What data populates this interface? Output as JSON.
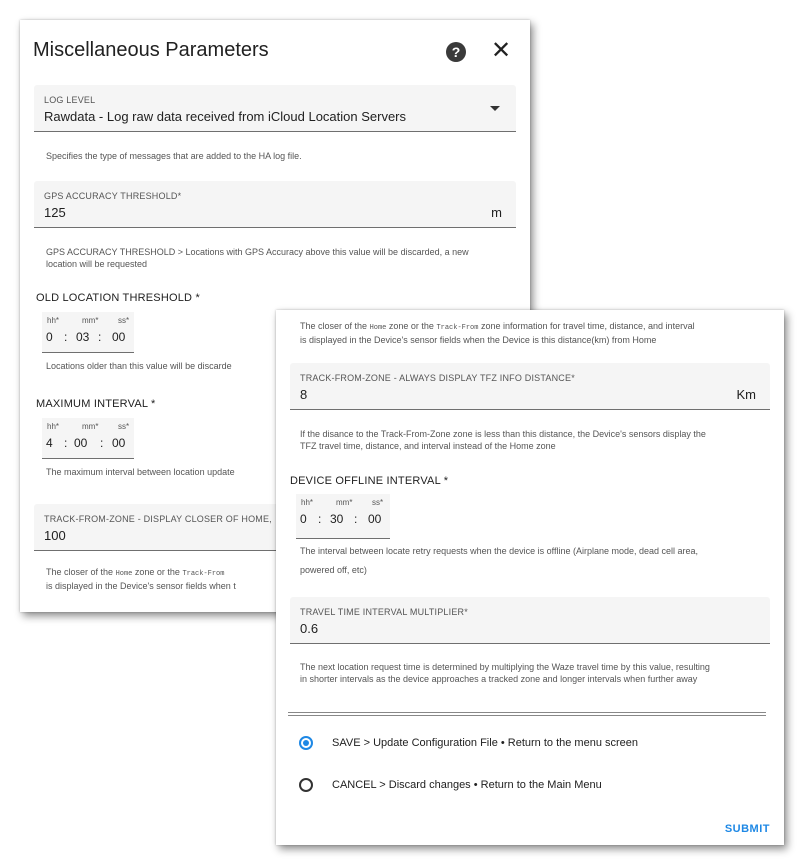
{
  "panel1": {
    "title": "Miscellaneous Parameters",
    "help_icon": "?",
    "close_icon": "✕",
    "log_level": {
      "label": "LOG LEVEL",
      "value": "Rawdata - Log raw data received from iCloud Location Servers",
      "helper": "Specifies the type of messages that are added to the HA log file."
    },
    "gps_accuracy": {
      "label": "GPS ACCURACY THRESHOLD*",
      "value": "125",
      "unit": "m",
      "helper1": "GPS ACCURACY THRESHOLD > Locations with GPS Accuracy above this value will be discarded, a new",
      "helper2": "location will be requested"
    },
    "old_location": {
      "title": "OLD LOCATION THRESHOLD *",
      "hh_label": "hh*",
      "mm_label": "mm*",
      "ss_label": "ss*",
      "hh": "0",
      "mm": "03",
      "ss": "00",
      "helper": "Locations older than this value will be discarde"
    },
    "max_interval": {
      "title": "MAXIMUM INTERVAL *",
      "hh_label": "hh*",
      "mm_label": "mm*",
      "ss_label": "ss*",
      "hh": "4",
      "mm": "00",
      "ss": "00",
      "helper": "The maximum interval between location update"
    },
    "track_from_zone": {
      "label": "TRACK-FROM-ZONE - DISPLAY CLOSER OF HOME,",
      "value": "100",
      "helper1_a": "The closer of the",
      "helper1_code1": "Home",
      "helper1_b": "zone or the",
      "helper1_code2": "Track-From",
      "helper2": "is displayed in the Device's sensor fields when t"
    }
  },
  "panel2": {
    "top_helper_a": "The closer of the",
    "top_helper_code1": "Home",
    "top_helper_b": "zone or the",
    "top_helper_code2": "Track-From",
    "top_helper_c": "zone information for travel time, distance, and interval",
    "top_helper2": "is displayed in the Device's sensor fields when the Device is this distance(km) from Home",
    "tfz_distance": {
      "label": "TRACK-FROM-ZONE - ALWAYS DISPLAY TFZ INFO DISTANCE*",
      "value": "8",
      "unit": "Km",
      "helper1": "If the disance to the Track-From-Zone zone is less than this distance, the Device's sensors display the",
      "helper2": "TFZ travel time, distance, and interval instead of the Home zone"
    },
    "offline_interval": {
      "title": "DEVICE OFFLINE INTERVAL *",
      "hh_label": "hh*",
      "mm_label": "mm*",
      "ss_label": "ss*",
      "hh": "0",
      "mm": "30",
      "ss": "00",
      "helper1": "The interval between locate retry requests when the device is offline (Airplane mode, dead cell area,",
      "helper2": "powered off, etc)"
    },
    "travel_multiplier": {
      "label": "TRAVEL TIME INTERVAL MULTIPLIER*",
      "value": "0.6",
      "helper1": "The next location request time is determined by multiplying the Waze travel time by this value, resulting",
      "helper2": "in shorter intervals as the device approaches a tracked zone and longer intervals when further away"
    },
    "actions": [
      {
        "label": "SAVE > Update Configuration File • Return to the menu screen",
        "checked": true
      },
      {
        "label": "CANCEL > Discard changes • Return to the Main Menu",
        "checked": false
      }
    ],
    "submit": "SUBMIT"
  },
  "colors": {
    "accent": "#1e88e5",
    "field_bg": "#f5f5f5"
  }
}
